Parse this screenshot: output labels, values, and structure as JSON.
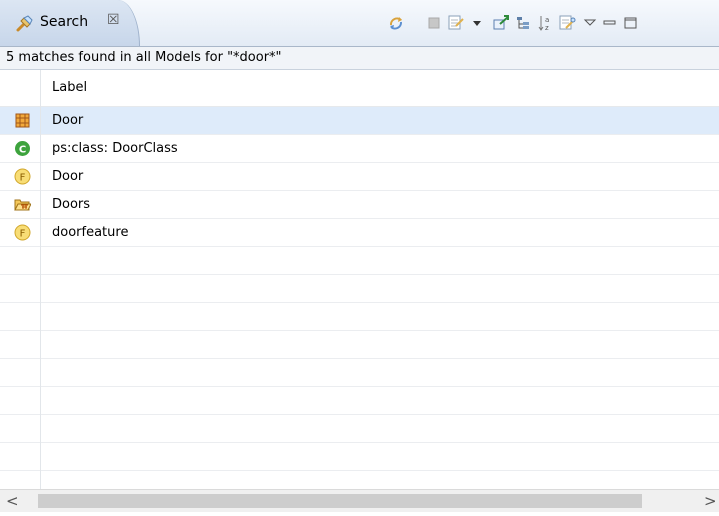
{
  "tab": {
    "title": "Search",
    "close_glyph": "☒",
    "icon": "search-flashlight-icon"
  },
  "toolbar": {
    "icons": [
      "sync-icon",
      "stop-icon",
      "pin-search-icon",
      "dropdown-arrow-icon",
      "export-icon",
      "tree-view-icon",
      "sort-icon",
      "search-history-icon",
      "view-menu-icon",
      "minimize-icon",
      "maximize-icon"
    ]
  },
  "status_text": "5 matches found in all Models for \"*door*\"",
  "table": {
    "column_header": "Label",
    "rows": [
      {
        "label": "Door",
        "icon": "component-grid-icon",
        "selected": true
      },
      {
        "label": "ps:class: DoorClass",
        "icon": "class-c-icon",
        "selected": false
      },
      {
        "label": "Door",
        "icon": "feature-f-icon",
        "selected": false
      },
      {
        "label": "Doors",
        "icon": "folder-open-icon",
        "selected": false
      },
      {
        "label": "doorfeature",
        "icon": "feature-f-icon",
        "selected": false
      }
    ]
  },
  "scrollbar": {
    "left": "<",
    "right": ">"
  },
  "colors": {
    "selection": "#deebfa",
    "tab": "#c7d6ea",
    "class_icon": "#3da33d",
    "feature_icon": "#f2d35a"
  }
}
